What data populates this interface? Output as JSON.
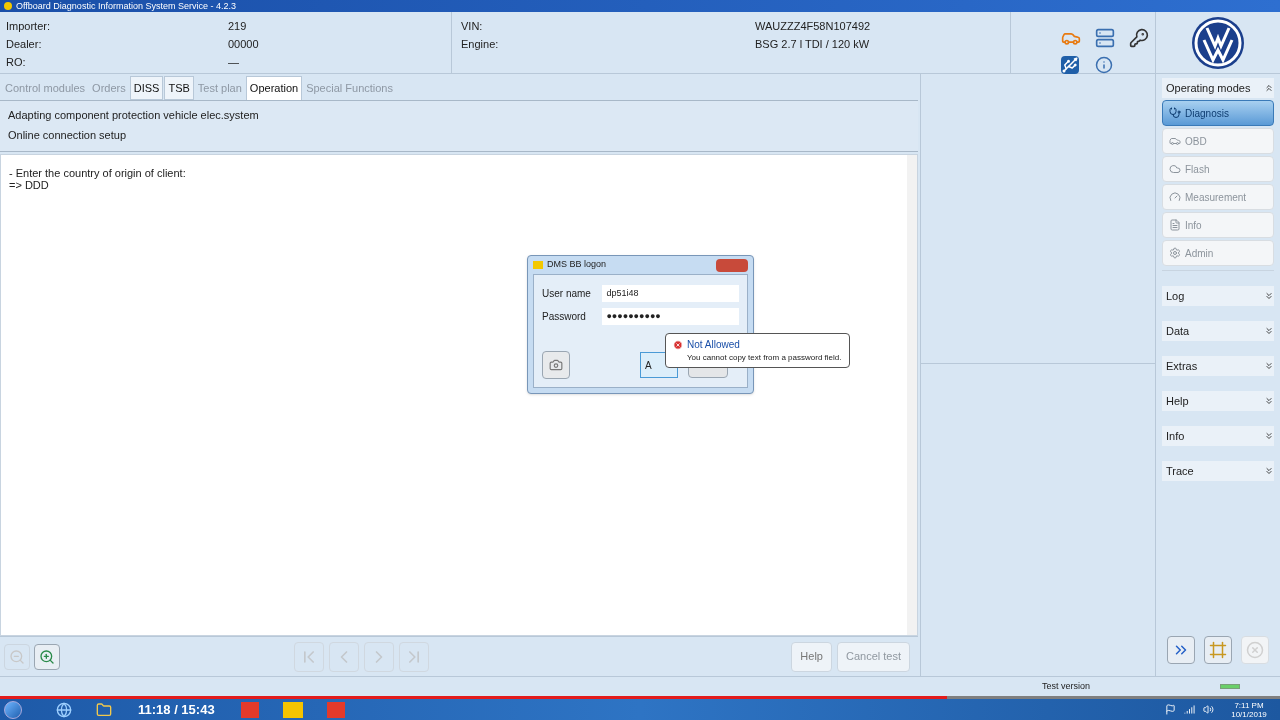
{
  "window": {
    "title": "Offboard Diagnostic Information System Service - 4.2.3"
  },
  "header": {
    "fields": [
      {
        "label": "Importer:",
        "value": "219"
      },
      {
        "label": "Dealer:",
        "value": "00000"
      },
      {
        "label": "RO:",
        "value": "—"
      }
    ],
    "vehicle": [
      {
        "label": "VIN:",
        "value": "WAUZZZ4F58N107492"
      },
      {
        "label": "Engine:",
        "value": "BSG 2.7 l TDI / 120 kW"
      }
    ]
  },
  "tabs": [
    {
      "label": "Control modules",
      "selected": false,
      "disabled": true
    },
    {
      "label": "Orders",
      "selected": false,
      "disabled": true
    },
    {
      "label": "DISS",
      "selected": false,
      "disabled": false
    },
    {
      "label": "TSB",
      "selected": false,
      "disabled": false
    },
    {
      "label": "Test plan",
      "selected": false,
      "disabled": true
    },
    {
      "label": "Operation",
      "selected": true,
      "disabled": false
    },
    {
      "label": "Special Functions",
      "selected": false,
      "disabled": true
    }
  ],
  "procedure": {
    "lines": [
      "Adapting component protection vehicle elec.system",
      "Online connection setup"
    ],
    "output": [
      "- Enter the country of origin of client:",
      "=> DDD"
    ]
  },
  "dialog": {
    "title": "DMS BB logon",
    "fields": [
      {
        "label": "User name",
        "value": "dp51i48"
      },
      {
        "label": "Password",
        "value": "●●●●●●●●●●"
      }
    ],
    "accept": "A"
  },
  "tooltip": {
    "title": "Not Allowed",
    "message": "You cannot copy text from a password field."
  },
  "toolbar": {
    "buttons": [
      {
        "label": "Help",
        "disabled": false
      },
      {
        "label": "Cancel test",
        "disabled": true
      }
    ]
  },
  "sidebar": {
    "sections": [
      {
        "title": "Operating modes",
        "expanded": true,
        "items": [
          {
            "label": "Diagnosis",
            "selected": true
          },
          {
            "label": "OBD",
            "selected": false
          },
          {
            "label": "Flash",
            "selected": false
          },
          {
            "label": "Measurement",
            "selected": false
          },
          {
            "label": "Info",
            "selected": false
          },
          {
            "label": "Admin",
            "selected": false
          }
        ]
      },
      {
        "title": "Log",
        "expanded": false
      },
      {
        "title": "Data",
        "expanded": false
      },
      {
        "title": "Extras",
        "expanded": false
      },
      {
        "title": "Help",
        "expanded": false
      },
      {
        "title": "Info",
        "expanded": false
      },
      {
        "title": "Trace",
        "expanded": false
      }
    ]
  },
  "status_bar": {
    "text": "Test version"
  },
  "video": {
    "time": "11:18 / 15:43",
    "level": 0.74
  },
  "taskbar": {
    "time": "7:11 PM",
    "date": "10/1/2019"
  }
}
